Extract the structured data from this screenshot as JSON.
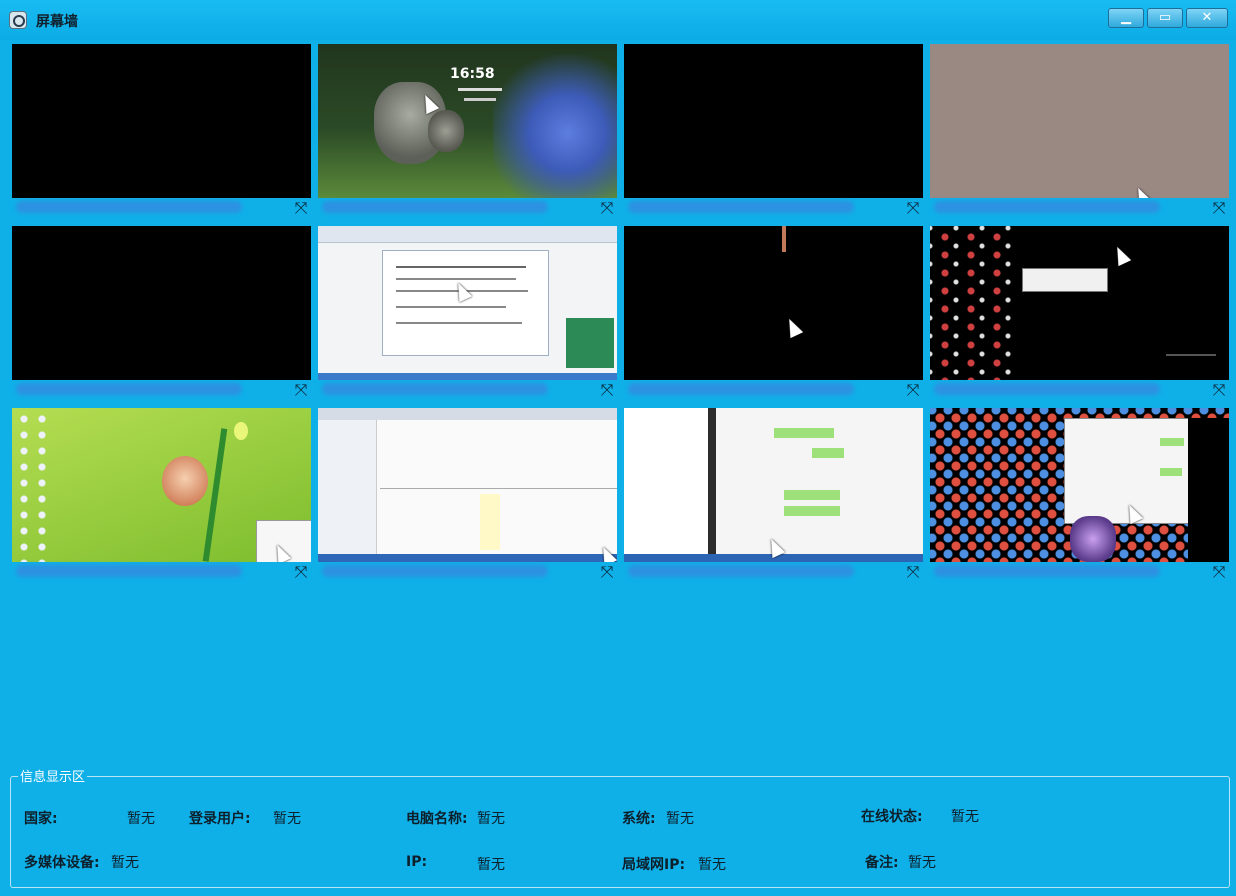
{
  "window": {
    "title": "屏幕墙"
  },
  "tiles": [
    {
      "variant": "black"
    },
    {
      "variant": "lockscreen",
      "clock": "16:58"
    },
    {
      "variant": "black"
    },
    {
      "variant": "taupe"
    },
    {
      "variant": "black"
    },
    {
      "variant": "document"
    },
    {
      "variant": "dark-cursor"
    },
    {
      "variant": "desktop-dark"
    },
    {
      "variant": "green-desktop"
    },
    {
      "variant": "ide"
    },
    {
      "variant": "chat"
    },
    {
      "variant": "desktop-icons"
    }
  ],
  "info": {
    "legend": "信息显示区",
    "row1": [
      {
        "label": "国家:",
        "value": "暂无"
      },
      {
        "label": "登录用户:",
        "value": "暂无"
      },
      {
        "label": "电脑名称:",
        "value": "暂无"
      },
      {
        "label": "系统:",
        "value": "暂无"
      },
      {
        "label": "在线状态:",
        "value": "暂无"
      }
    ],
    "row2": [
      {
        "label": "多媒体设备:",
        "value": "暂无"
      },
      {
        "label": "IP:",
        "value": "暂无"
      },
      {
        "label": "局域网IP:",
        "value": "暂无"
      },
      {
        "label": "备注:",
        "value": "暂无"
      }
    ]
  },
  "colors": {
    "background": "#0fb0e8",
    "screen_off": "#000000"
  }
}
